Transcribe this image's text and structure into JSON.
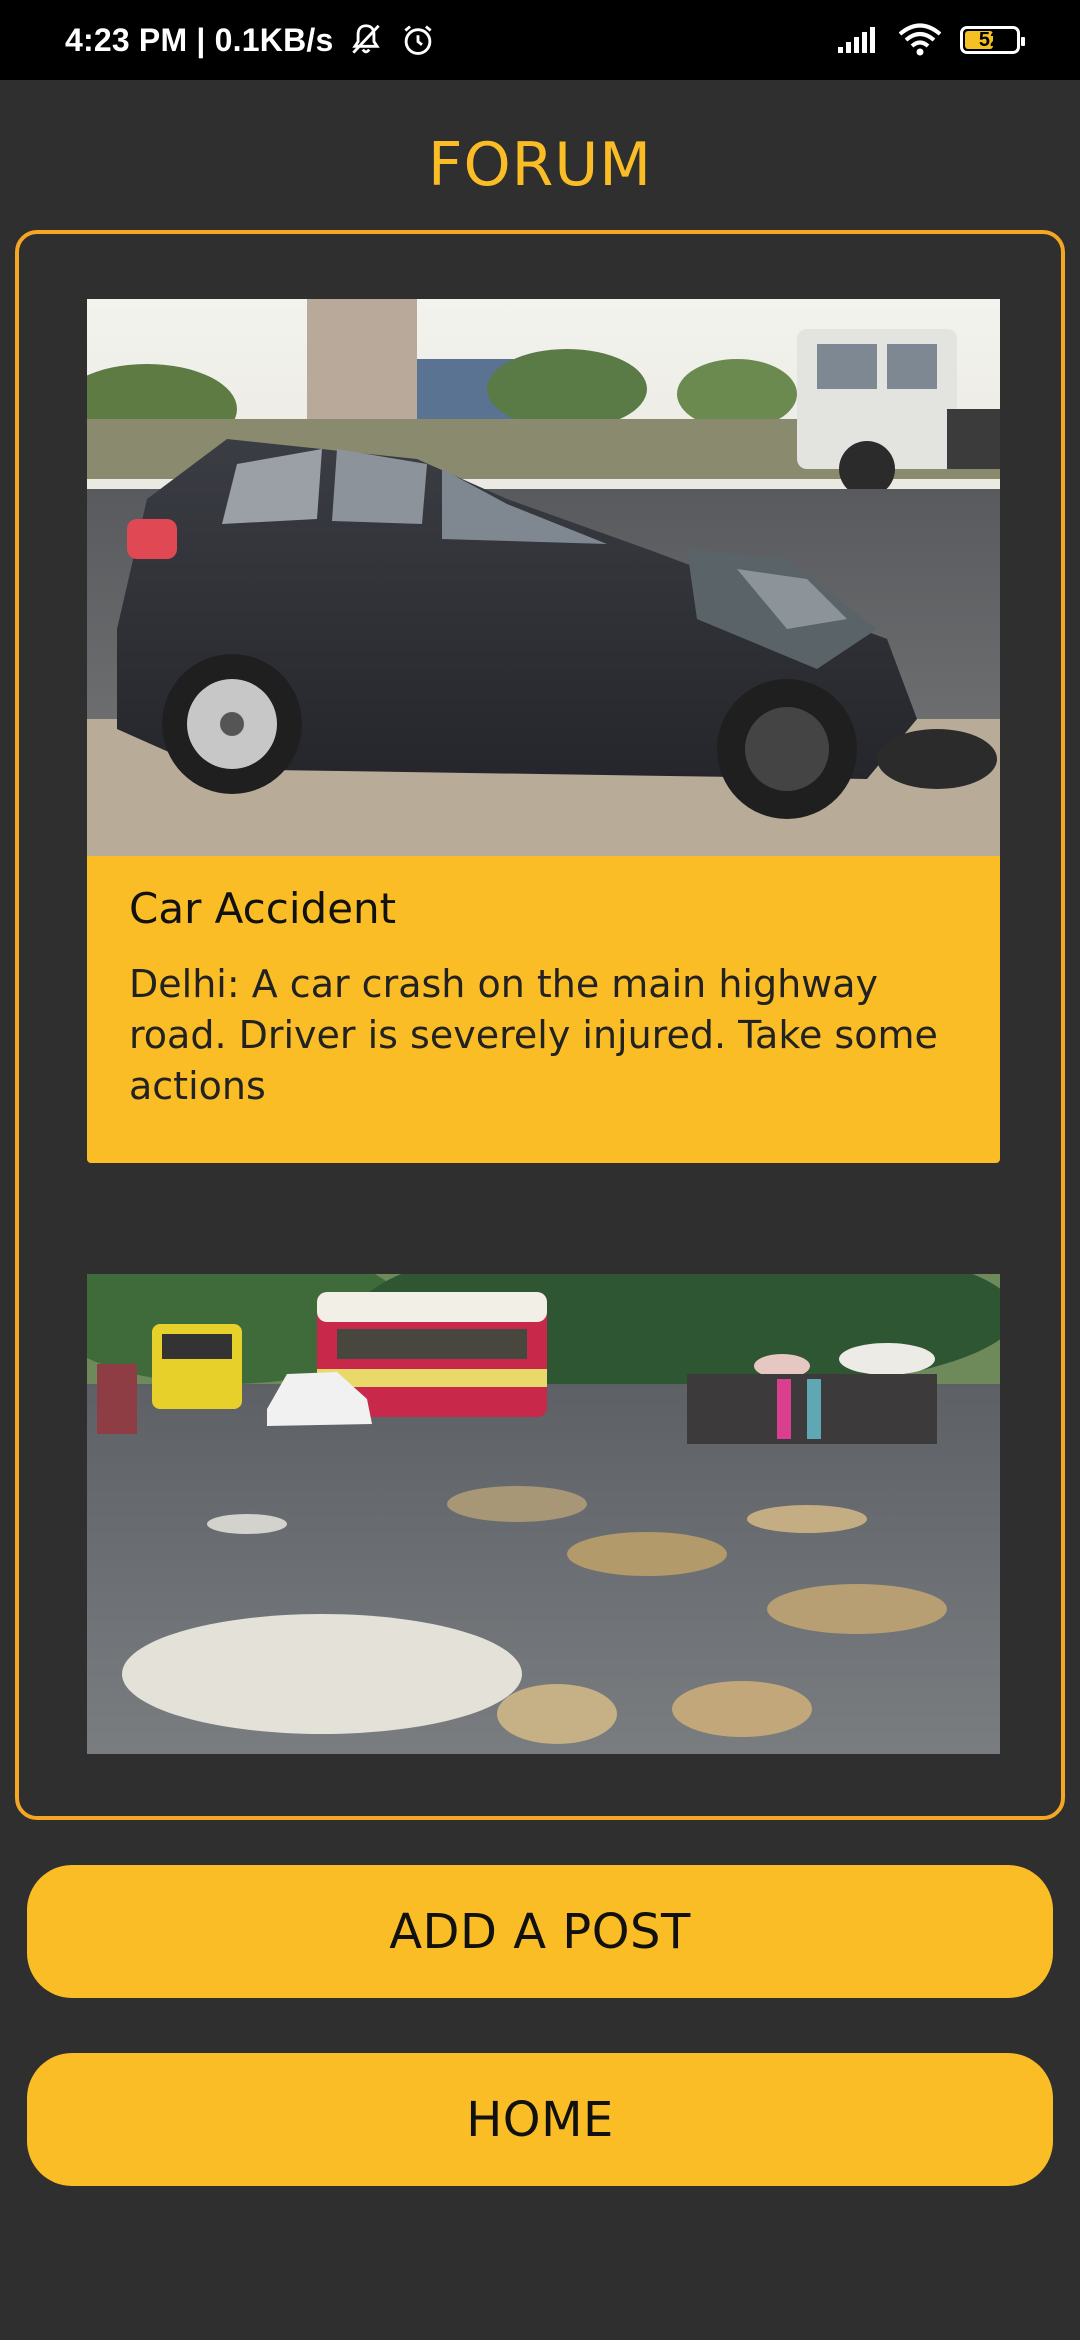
{
  "status_bar": {
    "time_speed": "4:23 PM | 0.1KB/s",
    "battery": "52",
    "icons": [
      "mute-bell-icon",
      "alarm-icon",
      "signal-icon",
      "wifi-icon",
      "battery-icon"
    ]
  },
  "header": {
    "title": "FORUM"
  },
  "posts": [
    {
      "image": "car-crash-photo",
      "title": "Car Accident",
      "text": "Delhi: A car crash on the main highway road. Driver is severely injured. Take some actions"
    },
    {
      "image": "pothole-road-photo",
      "title": "",
      "text": ""
    }
  ],
  "buttons": {
    "add_post": "ADD A POST",
    "home": "HOME"
  },
  "colors": {
    "background": "#2f2f2f",
    "accent": "#fbbd26",
    "border": "#f5a623"
  }
}
